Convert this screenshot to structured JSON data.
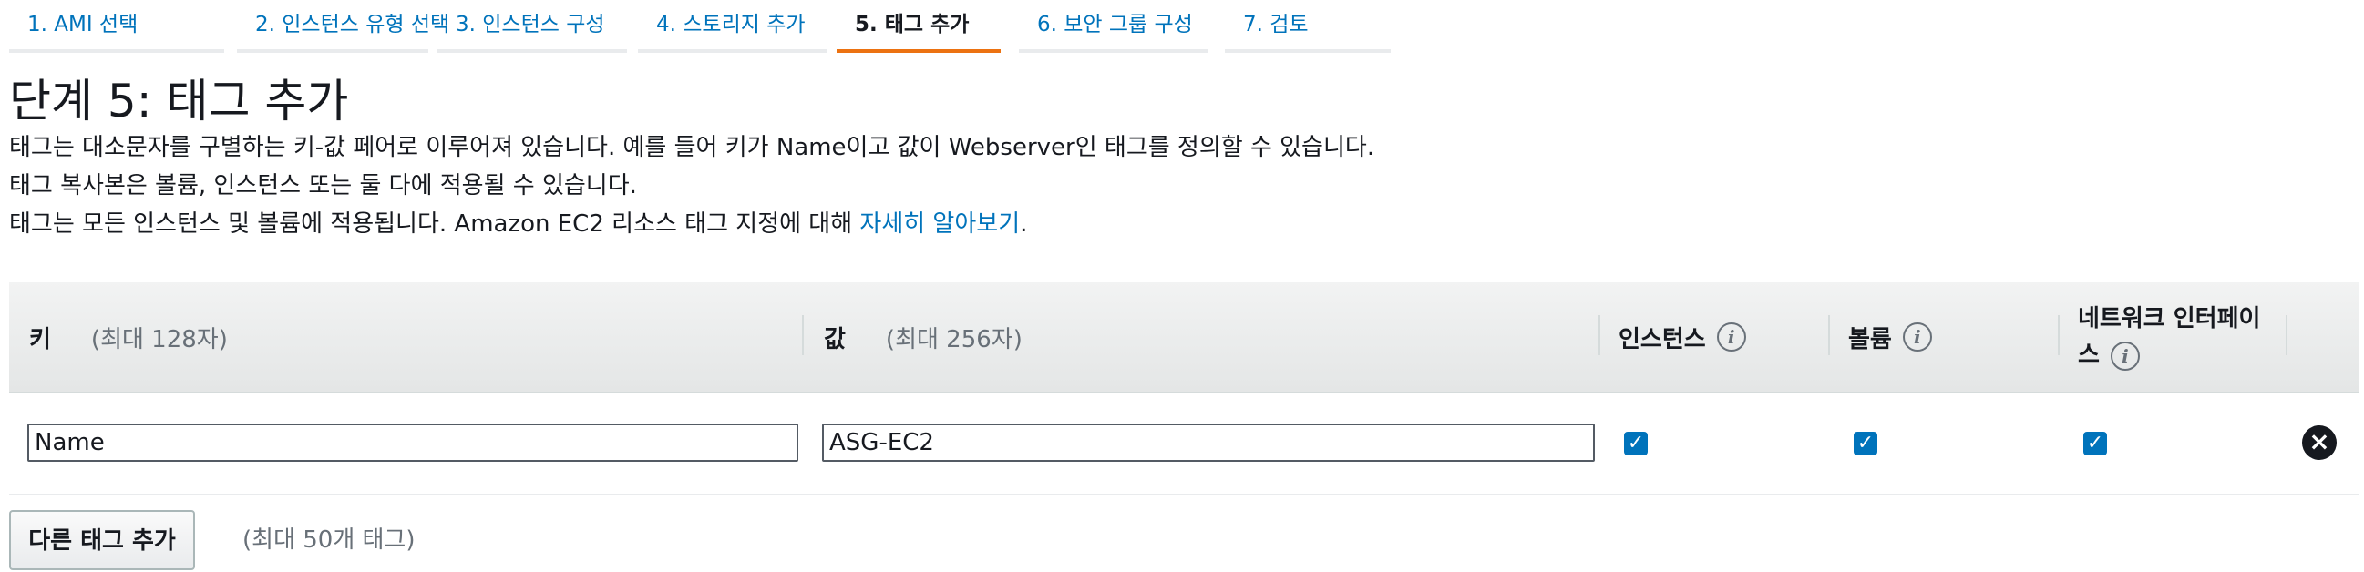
{
  "tabs": [
    {
      "label": "1. AMI 선택"
    },
    {
      "label": "2. 인스턴스 유형 선택"
    },
    {
      "label": "3. 인스턴스 구성"
    },
    {
      "label": "4. 스토리지 추가"
    },
    {
      "label": "5. 태그 추가",
      "active": true
    },
    {
      "label": "6. 보안 그룹 구성"
    },
    {
      "label": "7. 검토"
    }
  ],
  "page": {
    "title": "단계 5: 태그 추가",
    "desc1": "태그는 대소문자를 구별하는 키-값 페어로 이루어져 있습니다. 예를 들어 키가 Name이고 값이 Webserver인 태그를 정의할 수 있습니다.",
    "desc2": "태그 복사본은 볼륨, 인스턴스 또는 둘 다에 적용될 수 있습니다.",
    "desc3": "태그는 모든 인스턴스 및 볼륨에 적용됩니다. Amazon EC2 리소스 태그 지정에 대해",
    "learn_more": "자세히 알아보기",
    "desc3_end": "."
  },
  "table": {
    "headers": {
      "key": "키",
      "key_hint": "(최대 128자)",
      "value": "값",
      "value_hint": "(최대 256자)",
      "instances": "인스턴스",
      "volumes": "볼륨",
      "eni_line1": "네트워크 인터페이",
      "eni_line2": "스"
    },
    "rows": [
      {
        "key": "Name",
        "value": "ASG-EC2",
        "instances": true,
        "volumes": true,
        "eni": true
      }
    ]
  },
  "actions": {
    "add_tag": "다른 태그 추가",
    "limit": "(최대 50개 태그)"
  },
  "colors": {
    "accent": "#ec7211",
    "link": "#0073bb",
    "checkbox": "#0073bb"
  }
}
